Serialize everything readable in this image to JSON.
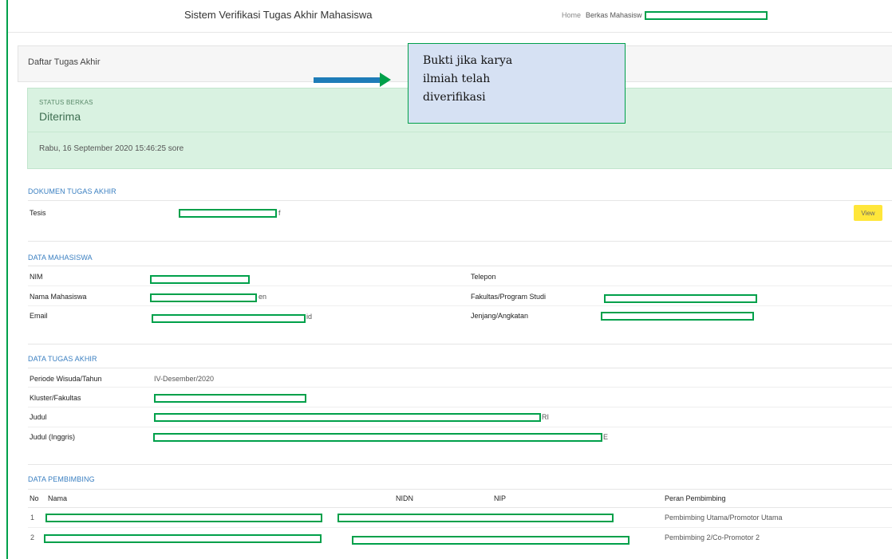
{
  "header": {
    "app_title": "Sistem Verifikasi Tugas Akhir Mahasiswa",
    "breadcrumb_home": "Home",
    "breadcrumb_current": "Berkas Mahasisw"
  },
  "panel": {
    "title": "Daftar Tugas Akhir"
  },
  "annotation": {
    "line1": "Bukti jika karya",
    "line2": "ilmiah telah",
    "line3": "diverifikasi"
  },
  "status": {
    "label": "STATUS BERKAS",
    "value": "Diterima",
    "date": "Rabu, 16 September 2020 15:46:25 sore"
  },
  "dokumen": {
    "section_title": "DOKUMEN TUGAS AKHIR",
    "tesis_label": "Tesis",
    "tesis_value_suffix": "f",
    "view_label": "View"
  },
  "mahasiswa": {
    "section_title": "DATA MAHASISWA",
    "nim_label": "NIM",
    "nama_label": "Nama Mahasiswa",
    "nama_suffix": "en",
    "email_label": "Email",
    "email_suffix": "id",
    "telepon_label": "Telepon",
    "fakultas_label": "Fakultas/Program Studi",
    "jenjang_label": "Jenjang/Angkatan"
  },
  "tugas_akhir": {
    "section_title": "DATA TUGAS AKHIR",
    "periode_label": "Periode Wisuda/Tahun",
    "periode_value": "IV-Desember/2020",
    "kluster_label": "Kluster/Fakultas",
    "judul_label": "Judul",
    "judul_suffix": "RI",
    "judul_inggris_label": "Judul (Inggris)",
    "judul_inggris_suffix": "E"
  },
  "pembimbing": {
    "section_title": "DATA PEMBIMBING",
    "columns": {
      "no": "No",
      "nama": "Nama",
      "nidn": "NIDN",
      "nip": "NIP",
      "peran": "Peran Pembimbing"
    },
    "rows": [
      {
        "no": "1",
        "peran": "Pembimbing Utama/Promotor Utama"
      },
      {
        "no": "2",
        "peran": "Pembimbing 2/Co-Promotor 2"
      }
    ]
  }
}
